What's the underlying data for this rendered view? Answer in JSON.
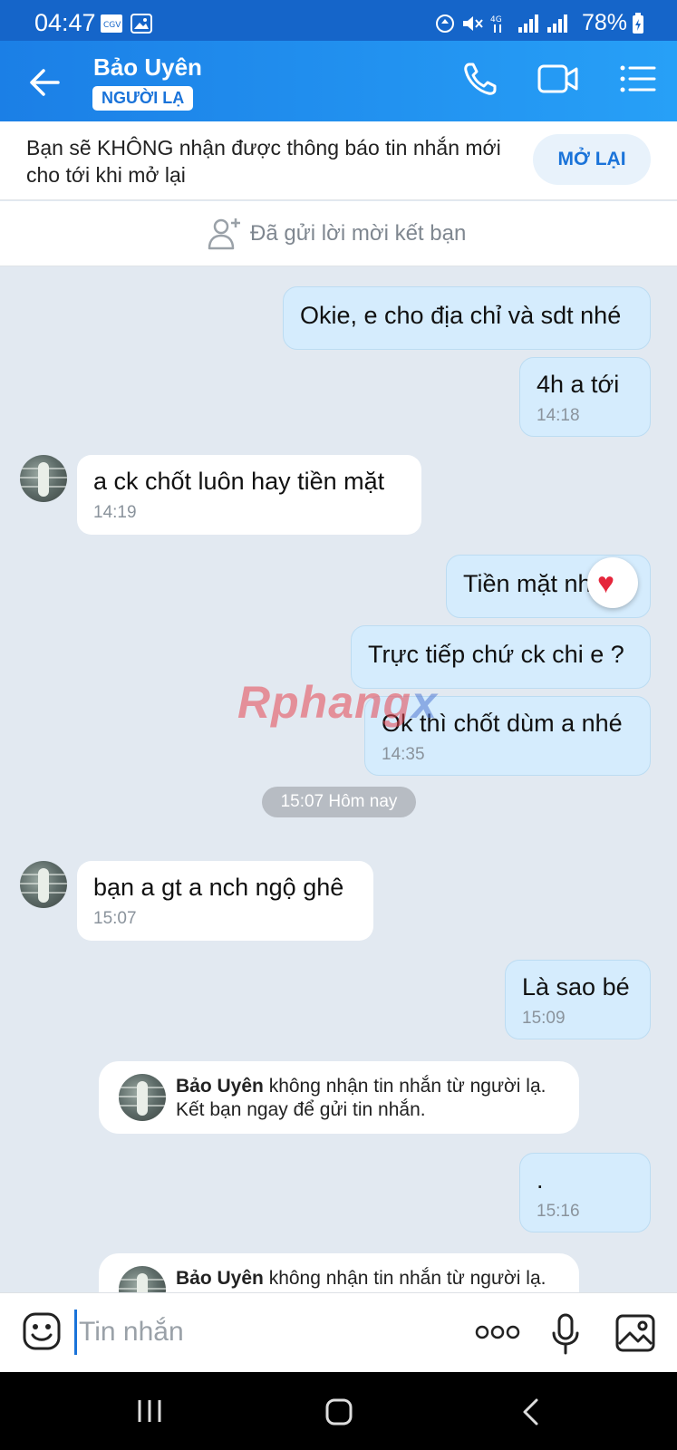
{
  "status_bar": {
    "time": "04:47",
    "battery": "78%"
  },
  "header": {
    "contact_name": "Bảo Uyên",
    "badge": "NGƯỜI LẠ"
  },
  "notice": {
    "text": "Bạn sẽ KHÔNG nhận được thông báo tin nhắn mới cho tới khi mở lại",
    "button": "MỞ LẠI"
  },
  "friend_request": {
    "text": "Đã gửi lời mời kết bạn"
  },
  "messages": [
    {
      "dir": "out",
      "text": "Okie, e cho địa chỉ và sdt nhé",
      "time": ""
    },
    {
      "dir": "out",
      "text": "4h a tới",
      "time": "14:18"
    },
    {
      "dir": "in",
      "text": "a ck chốt luôn hay tiền mặt",
      "time": "14:19"
    },
    {
      "dir": "out",
      "text": "Tiền mặt nhé",
      "time": ""
    },
    {
      "dir": "out",
      "text": "Trực tiếp chứ ck chi e ?",
      "time": ""
    },
    {
      "dir": "out",
      "text": "Ok thì chốt dùm a nhé",
      "time": "14:35"
    },
    {
      "dir": "in",
      "text": "bạn a gt a nch ngộ ghê",
      "time": "15:07"
    },
    {
      "dir": "out",
      "text": "Là sao bé",
      "time": "15:09"
    },
    {
      "dir": "out",
      "text": ".",
      "time": "15:16"
    }
  ],
  "date_divider": "15:07 Hôm nay",
  "system_notices": [
    {
      "name": "Bảo Uyên",
      "text": " không nhận tin nhắn từ người lạ.",
      "line2": "Kết bạn ngay để gửi tin nhắn."
    },
    {
      "name": "Bảo Uyên",
      "text": " không nhận tin nhắn từ người lạ.",
      "line2": ""
    }
  ],
  "reaction": "heart",
  "watermark": {
    "part1": "Rphang",
    "part2": "x"
  },
  "composer": {
    "placeholder": "Tin nhắn"
  },
  "colors": {
    "header_start": "#1b7fe6",
    "header_end": "#27a0f7",
    "outgoing_bubble": "#d5ecfd",
    "chat_bg": "#e2e9f1",
    "accent": "#1a73d9"
  }
}
